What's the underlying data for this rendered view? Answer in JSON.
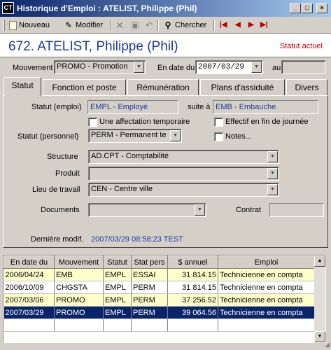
{
  "window": {
    "app_icon": "CT",
    "title": "Historique d'Emploi : ATELIST, Philippe (Phil)",
    "minimize": "_",
    "maximize": "□",
    "close": "×"
  },
  "toolbar": {
    "new_label": "Nouveau",
    "edit_label": "Modifier",
    "search_label": "Chercher"
  },
  "header": {
    "employee": "672. ATELIST, Philippe (Phil)",
    "status": "Statut actuel"
  },
  "movement": {
    "label": "Mouvement",
    "value": "PROMO - Promotion",
    "date_label": "En date du",
    "date_value": "2007/03/29",
    "to_label": "au",
    "to_value": ""
  },
  "tabs": [
    "Statut",
    "Fonction et poste",
    "Rémunération",
    "Plans d'assiduité",
    "Divers"
  ],
  "statut": {
    "emploi_label": "Statut (emploi)",
    "emploi_value": "EMPL - Employé",
    "suite_label": "suite à",
    "suite_value": "EMB - Embauche",
    "temp_label": "Une affectation temporaire",
    "end_day_label": "Effectif en fin de journée",
    "personnel_label": "Statut (personnel)",
    "personnel_value": "PERM - Permanent te",
    "notes_label": "Notes...",
    "structure_label": "Structure",
    "structure_value": "AD.CPT - Comptabilité",
    "produit_label": "Produit",
    "produit_value": "",
    "lieu_label": "Lieu de travail",
    "lieu_value": "CEN - Centre ville",
    "documents_label": "Documents",
    "documents_value": "",
    "contrat_label": "Contrat",
    "contrat_value": "",
    "modif_label": "Dernière modif.",
    "modif_value": "2007/03/29 08:58:23 TEST"
  },
  "grid": {
    "columns": [
      "En date du",
      "Mouvement",
      "Statut",
      "Stat pers",
      "$ annuel",
      "Emploi"
    ],
    "rows": [
      [
        "2006/04/24",
        "EMB",
        "EMPL",
        "ESSAI",
        "31 814.15",
        "Technicienne en compta"
      ],
      [
        "2006/10/09",
        "CHGSTA",
        "EMPL",
        "PERM",
        "31 814.15",
        "Technicienne en compta"
      ],
      [
        "2007/03/06",
        "PROMO",
        "EMPL",
        "PERM",
        "37 256.52",
        "Technicienne en compta"
      ],
      [
        "2007/03/29",
        "PROMO",
        "EMPL",
        "PERM",
        "39 064.56",
        "Technicienne en compta"
      ]
    ],
    "row_styles": [
      "yellow",
      "white",
      "yellow",
      "sel"
    ]
  }
}
